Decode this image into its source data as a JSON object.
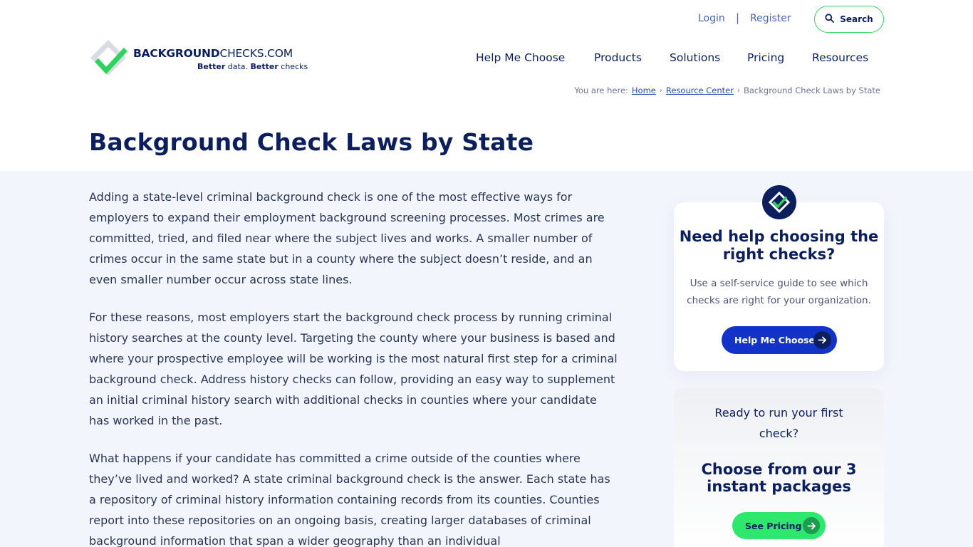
{
  "header": {
    "login_label": "Login",
    "separator": "|",
    "register_label": "Register",
    "search_label": "Search",
    "logo_word_bold": "BACKGROUND",
    "logo_word_regular": "CHECKS.COM",
    "logo_tag_1": "Better",
    "logo_tag_2": " data. ",
    "logo_tag_3": "Better",
    "logo_tag_4": " checks"
  },
  "nav": {
    "items": [
      "Help Me Choose",
      "Products",
      "Solutions",
      "Pricing",
      "Resources"
    ]
  },
  "breadcrumb": {
    "prefix": "You are here:",
    "home": "Home",
    "resource_center": "Resource Center",
    "current": "Background Check Laws by State"
  },
  "page": {
    "title": "Background Check Laws by State"
  },
  "article": {
    "paragraphs": [
      "Adding a state-level criminal background check is one of the most effective ways for employers to expand their employment background screening processes. Most crimes are committed, tried, and filed near where the subject lives and works. A smaller number of crimes occur in the same state but in a county where the subject doesn’t reside, and an even smaller number occur across state lines.",
      "For these reasons, most employers start the background check process by running criminal history searches at the county level. Targeting the county where your business is based and where your prospective employee will be working is the most natural first step for a criminal background check. Address history checks can follow, providing an easy way to supplement an initial criminal history search with additional checks in counties where your candidate has worked in the past.",
      "What happens if your candidate has committed a crime outside of the counties where they’ve lived and worked? A state criminal background check is the answer. Each state has a repository of criminal history information containing records from its counties. Counties report into these repositories on an ongoing basis, creating larger databases of criminal background information that span a wider geography than an individual"
    ]
  },
  "sidebar": {
    "help_card": {
      "title": "Need help choosing the right checks?",
      "text": "Use a self-service guide to see which checks are right for your organization.",
      "button_label": "Help Me Choose"
    },
    "pricing_card": {
      "lead": "Ready to run your first check?",
      "title": "Choose from our 3 instant packages",
      "button_label": "See Pricing"
    }
  },
  "colors": {
    "navy": "#0c1f5c",
    "green": "#2ee86d",
    "blue_button": "#1333c8",
    "band_bg": "#f3f5fc"
  },
  "icons": {
    "search": "search-icon",
    "logo": "logo-check-diamond-icon",
    "arrow": "arrow-right-icon"
  }
}
